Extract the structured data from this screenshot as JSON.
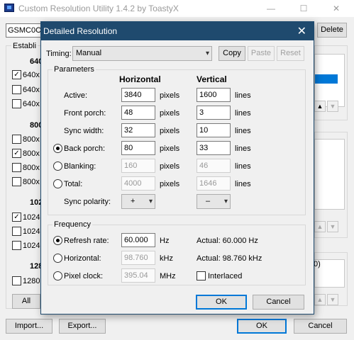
{
  "app": {
    "title": "Custom Resolution Utility 1.4.2 by ToastyX",
    "minimize": "—",
    "maximize": "☐",
    "close": "✕"
  },
  "background": {
    "monitor": "GSMC0C8",
    "delete_label": "Delete",
    "established_label": "Establi",
    "groups": [
      {
        "header": "640",
        "items": [
          {
            "label": "640x",
            "checked": true
          },
          {
            "label": "640x",
            "checked": false
          },
          {
            "label": "640x",
            "checked": false
          }
        ]
      },
      {
        "header": "800",
        "items": [
          {
            "label": "800x",
            "checked": false
          },
          {
            "label": "800x",
            "checked": true
          },
          {
            "label": "800x",
            "checked": false
          },
          {
            "label": "800x",
            "checked": false
          }
        ]
      },
      {
        "header": "102",
        "items": [
          {
            "label": "1024",
            "checked": true
          },
          {
            "label": "1024",
            "checked": false
          },
          {
            "label": "1024",
            "checked": false
          }
        ]
      },
      {
        "header": "128",
        "items": [
          {
            "label": "1280",
            "checked": false
          }
        ]
      }
    ],
    "all_label": "All",
    "import_label": "Import...",
    "export_label": "Export...",
    "ok_label": "OK",
    "cancel_label": "Cancel",
    "right_fragment": "0)"
  },
  "dialog": {
    "title": "Detailed Resolution",
    "close": "✕",
    "timing_label": "Timing:",
    "timing_value": "Manual",
    "copy_label": "Copy",
    "paste_label": "Paste",
    "reset_label": "Reset",
    "parameters": {
      "title": "Parameters",
      "col_horizontal": "Horizontal",
      "col_vertical": "Vertical",
      "rows": [
        {
          "label": "Active:",
          "radio": false,
          "h": "3840",
          "h_unit": "pixels",
          "v": "1600",
          "v_unit": "lines",
          "enabled": true
        },
        {
          "label": "Front porch:",
          "radio": false,
          "h": "48",
          "h_unit": "pixels",
          "v": "3",
          "v_unit": "lines",
          "enabled": true
        },
        {
          "label": "Sync width:",
          "radio": false,
          "h": "32",
          "h_unit": "pixels",
          "v": "10",
          "v_unit": "lines",
          "enabled": true
        },
        {
          "label": "Back porch:",
          "radio": true,
          "selected": true,
          "h": "80",
          "h_unit": "pixels",
          "v": "33",
          "v_unit": "lines",
          "enabled": true
        },
        {
          "label": "Blanking:",
          "radio": true,
          "selected": false,
          "h": "160",
          "h_unit": "pixels",
          "v": "46",
          "v_unit": "lines",
          "enabled": false
        },
        {
          "label": "Total:",
          "radio": true,
          "selected": false,
          "h": "4000",
          "h_unit": "pixels",
          "v": "1646",
          "v_unit": "lines",
          "enabled": false
        }
      ],
      "sync_polarity_label": "Sync polarity:",
      "sync_h": "+",
      "sync_v": "–"
    },
    "frequency": {
      "title": "Frequency",
      "refresh_label": "Refresh rate:",
      "refresh_value": "60.000",
      "refresh_unit": "Hz",
      "refresh_actual": "Actual: 60.000 Hz",
      "horizontal_label": "Horizontal:",
      "horizontal_value": "98.760",
      "horizontal_unit": "kHz",
      "horizontal_actual": "Actual: 98.760 kHz",
      "pixel_label": "Pixel clock:",
      "pixel_value": "395.04",
      "pixel_unit": "MHz",
      "interlaced_label": "Interlaced"
    },
    "ok_label": "OK",
    "cancel_label": "Cancel"
  }
}
